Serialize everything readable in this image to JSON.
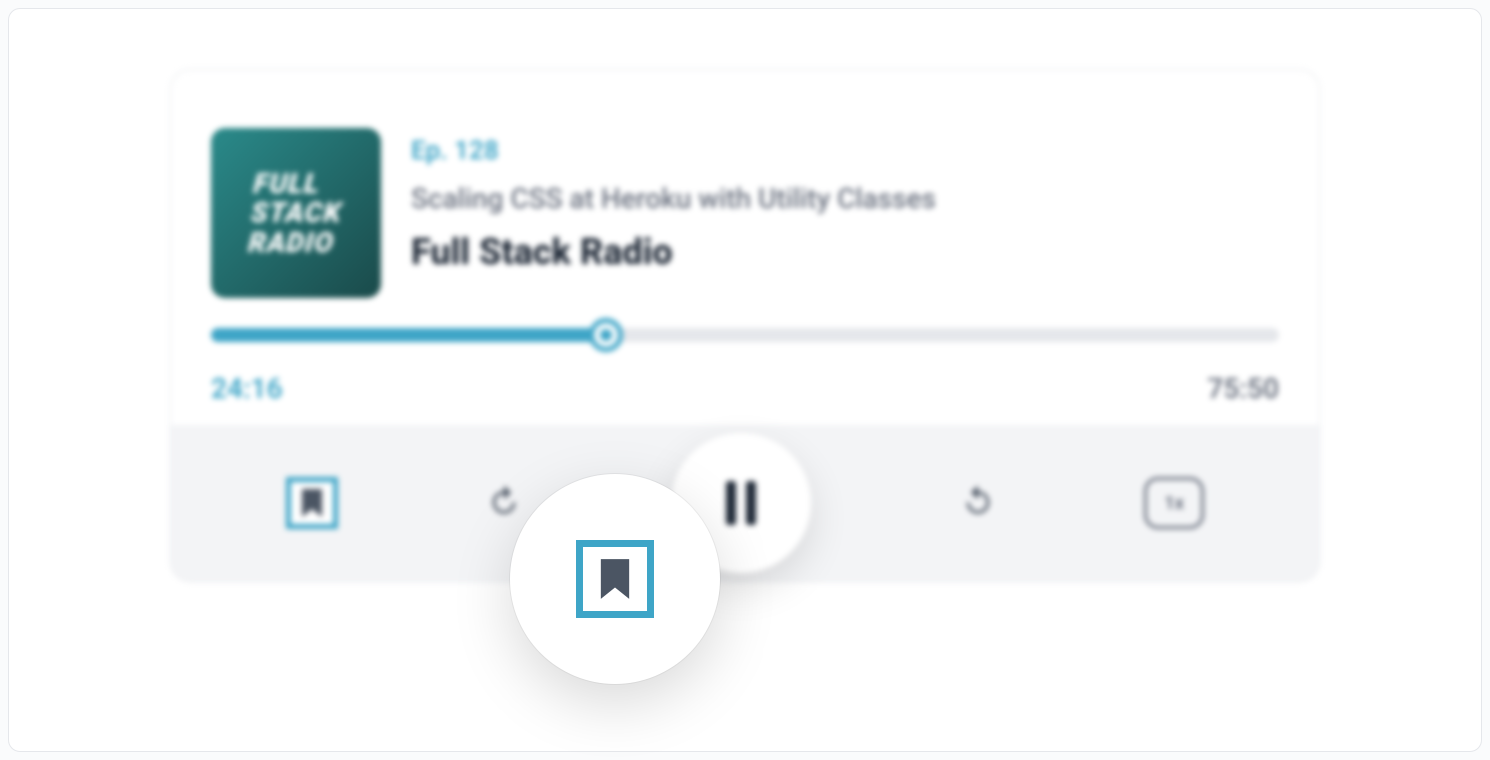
{
  "album": {
    "cover_text": "FULL\nSTACK\nRADIO"
  },
  "track": {
    "episode": "Ep. 128",
    "title": "Scaling CSS at Heroku with Utility Classes",
    "podcast": "Full Stack Radio"
  },
  "progress": {
    "current": "24:16",
    "total": "75:50",
    "percent": 37
  },
  "controls": {
    "speed_label": "1x"
  }
}
